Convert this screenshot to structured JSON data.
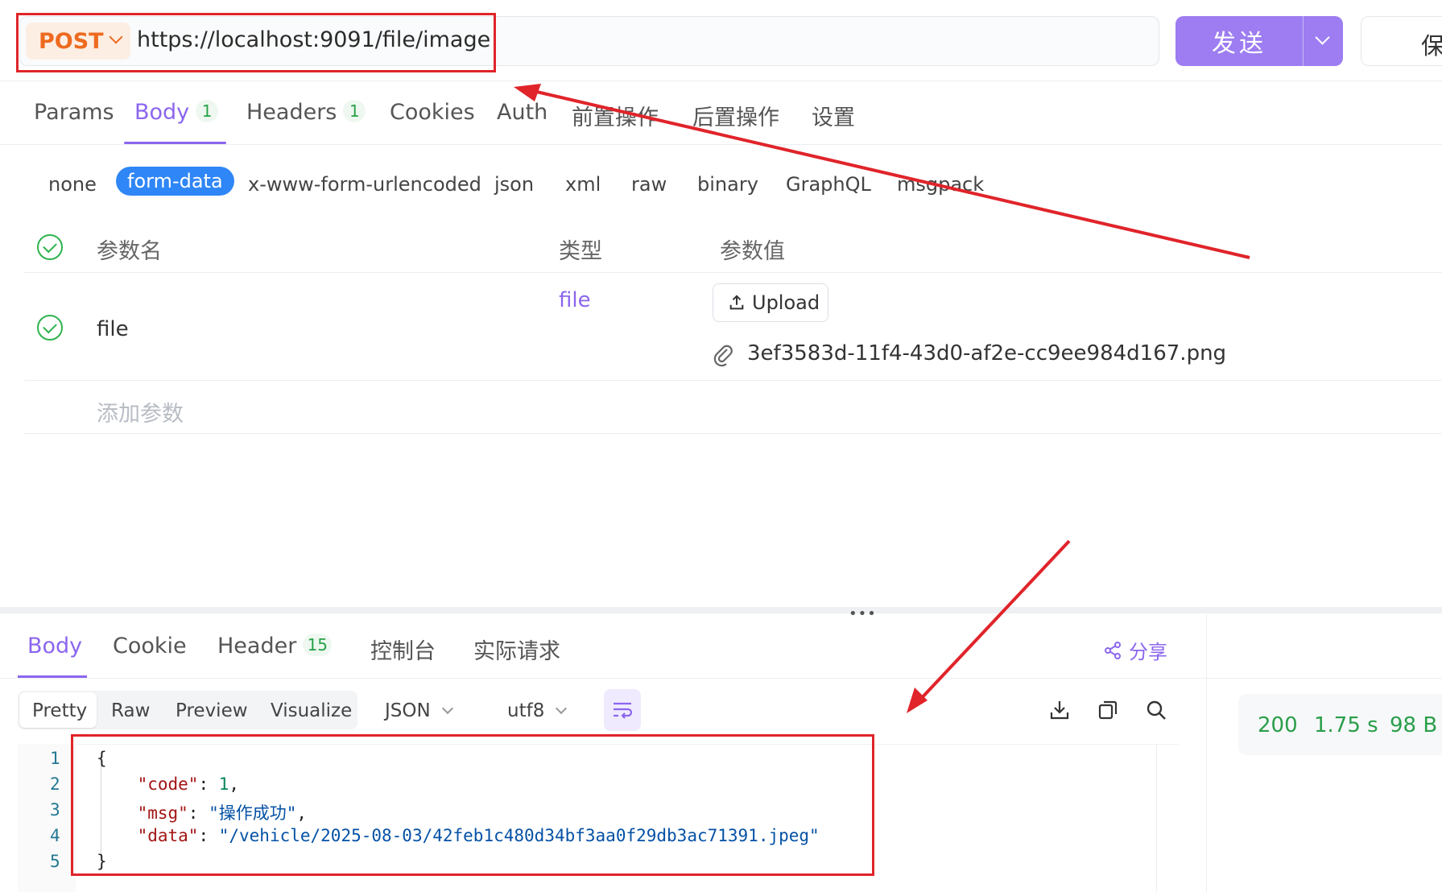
{
  "request": {
    "method": "POST",
    "url": "https://localhost:9091/file/image",
    "send_label": "发送",
    "save_label": "保"
  },
  "request_tabs": [
    {
      "label": "Params",
      "badge": null
    },
    {
      "label": "Body",
      "badge": "1"
    },
    {
      "label": "Headers",
      "badge": "1"
    },
    {
      "label": "Cookies",
      "badge": null
    },
    {
      "label": "Auth",
      "badge": null
    },
    {
      "label": "前置操作",
      "badge": null
    },
    {
      "label": "后置操作",
      "badge": null
    },
    {
      "label": "设置",
      "badge": null
    }
  ],
  "body_types": [
    "none",
    "form-data",
    "x-www-form-urlencoded",
    "json",
    "xml",
    "raw",
    "binary",
    "GraphQL",
    "msgpack"
  ],
  "params_table": {
    "headers": {
      "name": "参数名",
      "type": "类型",
      "value": "参数值"
    },
    "rows": [
      {
        "name": "file",
        "type": "file",
        "upload_label": "Upload",
        "file_name": "3ef3583d-11f4-43d0-af2e-cc9ee984d167.png"
      }
    ],
    "add_placeholder": "添加参数"
  },
  "response_tabs": [
    {
      "label": "Body",
      "badge": null
    },
    {
      "label": "Cookie",
      "badge": null
    },
    {
      "label": "Header",
      "badge": "15"
    },
    {
      "label": "控制台",
      "badge": null
    },
    {
      "label": "实际请求",
      "badge": null
    }
  ],
  "share_label": "分享",
  "view_modes": [
    "Pretty",
    "Raw",
    "Preview",
    "Visualize"
  ],
  "format": "JSON",
  "encoding": "utf8",
  "code": {
    "line_numbers": [
      "1",
      "2",
      "3",
      "4",
      "5"
    ],
    "open": "{",
    "close": "}",
    "fields": [
      {
        "key": "\"code\"",
        "value": "1",
        "kind": "number",
        "trail": ","
      },
      {
        "key": "\"msg\"",
        "value": "\"操作成功\"",
        "kind": "string",
        "trail": ","
      },
      {
        "key": "\"data\"",
        "value": "\"/vehicle/2025-08-03/42feb1c480d34bf3aa0f29db3ac71391.jpeg\"",
        "kind": "string",
        "trail": ""
      }
    ]
  },
  "status": {
    "code": "200",
    "time": "1.75 s",
    "size": "98 B"
  },
  "colors": {
    "accent": "#8b66ee",
    "method": "#ee6a1f",
    "annotation": "#e0242a",
    "success": "#2a9e4a"
  }
}
